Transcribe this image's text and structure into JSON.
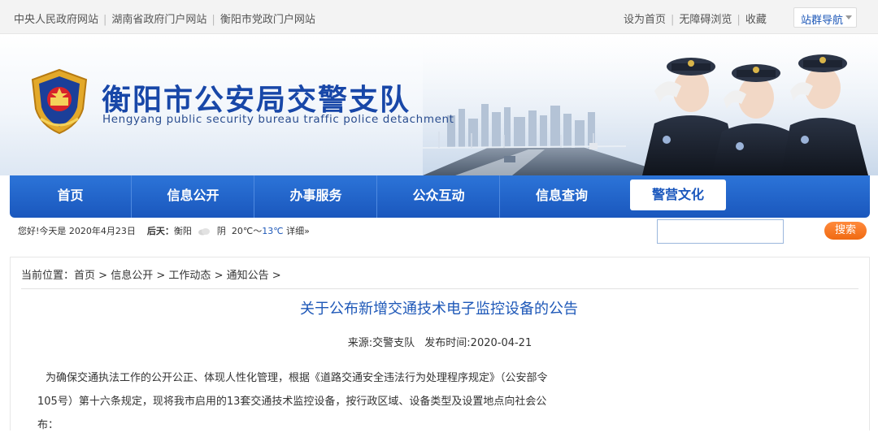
{
  "topbar": {
    "links": [
      "中央人民政府网站",
      "湖南省政府门户网站",
      "衡阳市党政门户网站"
    ],
    "right_links": [
      "设为首页",
      "无障碍浏览",
      "收藏"
    ],
    "site_nav_label": "站群导航"
  },
  "header": {
    "title": "衡阳市公安局交警支队",
    "subtitle": "Hengyang public security bureau traffic police detachment"
  },
  "nav": {
    "items": [
      {
        "label": "首页"
      },
      {
        "label": "信息公开"
      },
      {
        "label": "办事服务"
      },
      {
        "label": "公众互动"
      },
      {
        "label": "信息查询"
      },
      {
        "label": "警营文化"
      }
    ],
    "active_index": 5
  },
  "info": {
    "greeting": "您好!今天是 2020年4月23日",
    "tomorrow_label": "后天：",
    "city": "衡阳",
    "weather": "阴",
    "temp_high": "20℃",
    "temp_sep": "～",
    "temp_low": "13℃",
    "detail": "详细»"
  },
  "search": {
    "placeholder": "",
    "button_label": "搜索"
  },
  "breadcrumb": {
    "label": "当前位置：",
    "items": [
      "首页",
      "信息公开",
      "工作动态",
      "通知公告"
    ],
    "separator": ">"
  },
  "article": {
    "title": "关于公布新增交通技术电子监控设备的公告",
    "source": "来源:交警支队",
    "published": "发布时间:2020-04-21",
    "lines": [
      "为确保交通执法工作的公开公正、体现人性化管理，根据《道路交通安全违法行为处理程序规定》（公安部令",
      "105号）第十六条规定，现将我市启用的13套交通技术监控设备，按行政区域、设备类型及设置地点向社会公",
      "布："
    ]
  },
  "colors": {
    "brand_blue": "#1a57bd",
    "title_blue": "#1847a8",
    "search_orange": "#f06a12"
  }
}
